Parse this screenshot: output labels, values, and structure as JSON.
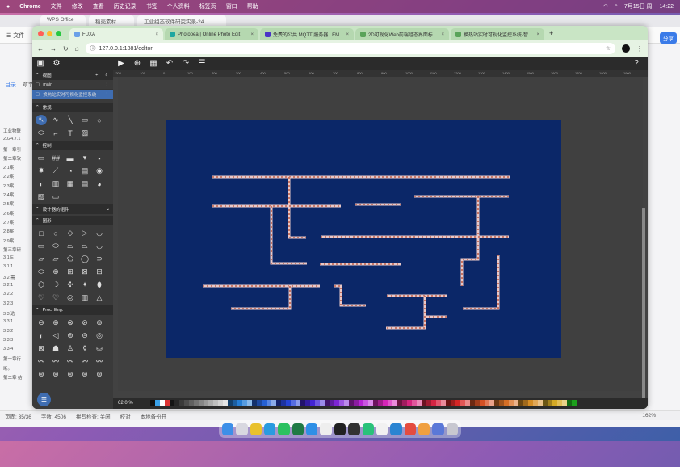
{
  "menubar": {
    "app": "Chrome",
    "items": [
      "文件",
      "修改",
      "查看",
      "历史记录",
      "书签",
      "个人资料",
      "标签页",
      "窗口",
      "帮助"
    ],
    "datetime": "7月15日 周一 14:22"
  },
  "bg_app": {
    "tabs": [
      "WPS Office",
      "稻壳素材",
      "工业组态软件研究实录-24"
    ],
    "toolbar": "☰ 文件",
    "outline_tab": "目录",
    "outline_tab2": "章节",
    "outline": [
      "工业物联",
      "2024.7.1",
      "第一章引",
      "第二章软",
      "2.1案",
      "2.2案",
      "2.3案",
      "2.4案",
      "2.5案",
      "2.6案",
      "2.7案",
      "2.8案",
      "2.9案",
      "第三章研",
      "3.1 E",
      "3.1.1",
      "3.2 需",
      "3.2.1",
      "3.2.2",
      "3.2.3",
      "3.3 选",
      "3.3.1",
      "3.3.2",
      "3.3.3",
      "3.3.4",
      "第一章行",
      "晰。",
      "第二章 结"
    ],
    "share": "分享",
    "status": [
      "页面: 35/36",
      "字数: 4506",
      "拼写检查: 关闭",
      "校对",
      "本地备份开"
    ],
    "zoom": "162%"
  },
  "browser": {
    "tabs": [
      {
        "label": "FUXA",
        "color": "#6aa0e8",
        "active": true
      },
      {
        "label": "Photopea | Online Photo Edit",
        "color": "#1ea7a0",
        "active": false
      },
      {
        "label": "免费的公共 MQTT 服务器 | EM",
        "color": "#4b34c7",
        "active": false
      },
      {
        "label": "2D可视化Web前端组态界面标",
        "color": "#5aa35a",
        "active": false
      },
      {
        "label": "换热站实时可视化监控系统-智",
        "color": "#5aa35a",
        "active": false
      }
    ],
    "url": "127.0.0.1:1881/editor"
  },
  "fuxa": {
    "sections": {
      "views": "视图",
      "general": "常规",
      "controls": "控制",
      "custom": "设计器的组件",
      "shapes": "图形",
      "proc": "Proc. Eng."
    },
    "views": [
      "main",
      "换热站实时可视化监控系统"
    ],
    "zoom": "62.0 %",
    "ruler": [
      "-200",
      "-100",
      "0",
      "100",
      "200",
      "300",
      "400",
      "500",
      "600",
      "700",
      "800",
      "900",
      "1000",
      "1100",
      "1200",
      "1300",
      "1400",
      "1500",
      "1600",
      "1700",
      "1800",
      "1900"
    ]
  },
  "pipes_color": "#e8c8c8",
  "canvas_color": "#0b2768"
}
